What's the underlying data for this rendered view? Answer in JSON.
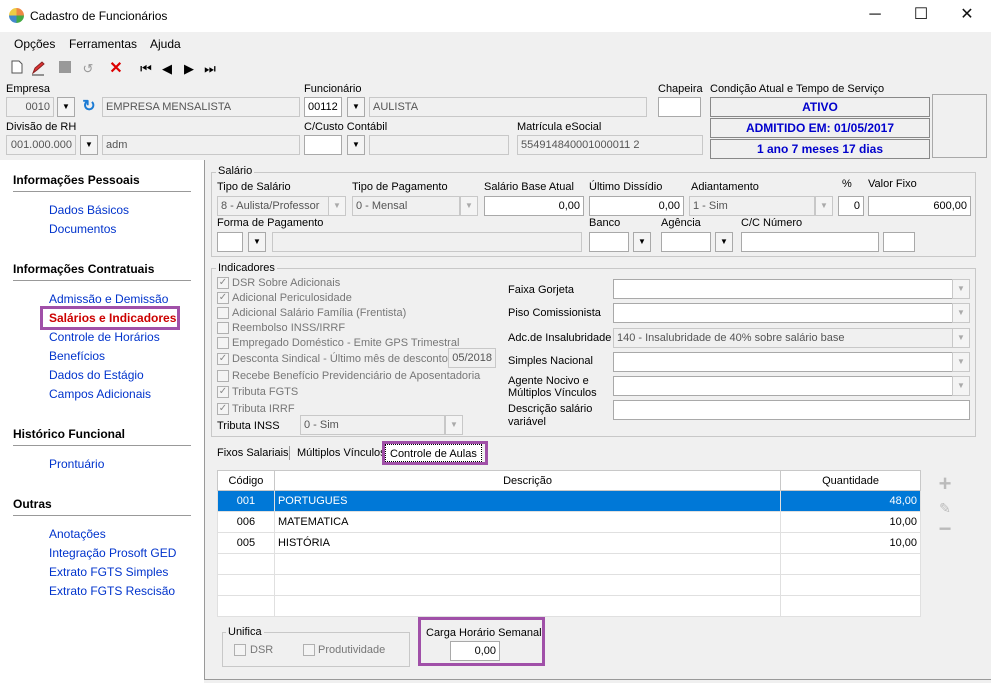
{
  "window": {
    "title": "Cadastro de Funcionários"
  },
  "menu": [
    "Opções",
    "Ferramentas",
    "Ajuda"
  ],
  "header": {
    "empresa_label": "Empresa",
    "empresa_code": "0010",
    "empresa_name": "EMPRESA MENSALISTA",
    "funcionario_label": "Funcionário",
    "funcionario_code": "00112",
    "funcionario_name": "AULISTA",
    "chapeira_label": "Chapeira",
    "chapeira_value": "",
    "condicao_label": "Condição Atual e Tempo de Serviço",
    "status": "ATIVO",
    "admitido": "ADMITIDO EM: 01/05/2017",
    "tempo": "1 ano 7 meses 17 dias",
    "divisao_label": "Divisão de RH",
    "divisao_code": "001.000.000",
    "divisao_name": "adm",
    "custo_label": "C/Custo Contábil",
    "matricula_label": "Matrícula eSocial",
    "matricula_value": "554914840001000011 2"
  },
  "sidebar": {
    "sections": [
      {
        "title": "Informações Pessoais",
        "items": [
          "Dados Básicos",
          "Documentos"
        ]
      },
      {
        "title": "Informações Contratuais",
        "items": [
          "Admissão e Demissão",
          "Salários e Indicadores",
          "Controle de Horários",
          "Benefícios",
          "Dados do Estágio",
          "Campos Adicionais"
        ]
      },
      {
        "title": "Histórico Funcional",
        "items": [
          "Prontuário"
        ]
      },
      {
        "title": "Outras",
        "items": [
          "Anotações",
          "Integração Prosoft GED",
          "Extrato FGTS Simples",
          "Extrato FGTS Rescisão"
        ]
      }
    ]
  },
  "salario": {
    "group_title": "Salário",
    "tipo_salario_label": "Tipo de Salário",
    "tipo_salario_value": "8 - Aulista/Professor",
    "tipo_pagamento_label": "Tipo de Pagamento",
    "tipo_pagamento_value": "0 - Mensal",
    "salario_base_label": "Salário Base Atual",
    "salario_base_value": "0,00",
    "ultimo_dissidio_label": "Último Dissídio",
    "ultimo_dissidio_value": "0,00",
    "adiantamento_label": "Adiantamento",
    "adiantamento_value": "1 - Sim",
    "percent_label": "%",
    "percent_value": "0",
    "valor_fixo_label": "Valor Fixo",
    "valor_fixo_value": "600,00",
    "forma_pagamento_label": "Forma de Pagamento",
    "banco_label": "Banco",
    "agencia_label": "Agência",
    "cc_label": "C/C Número"
  },
  "indicadores": {
    "group_title": "Indicadores",
    "checkboxes": [
      {
        "label": "DSR Sobre Adicionais",
        "checked": "✓"
      },
      {
        "label": "Adicional Periculosidade",
        "checked": "✓"
      },
      {
        "label": "Adicional Salário Família (Frentista)",
        "checked": ""
      },
      {
        "label": "Reembolso INSS/IRRF",
        "checked": ""
      },
      {
        "label": "Empregado Doméstico - Emite GPS Trimestral",
        "checked": ""
      },
      {
        "label": "Desconta Sindical - Último mês de desconto",
        "checked": "✓"
      },
      {
        "label": "Recebe Benefício Previdenciário de Aposentadoria",
        "checked": ""
      },
      {
        "label": "Tributa FGTS",
        "checked": "✓"
      },
      {
        "label": "Tributa IRRF",
        "checked": "✓"
      }
    ],
    "sindical_date": "05/2018",
    "tributa_inss_label": "Tributa INSS",
    "tributa_inss_value": "0 - Sim",
    "faixa_gorjeta_label": "Faixa Gorjeta",
    "piso_label": "Piso Comissionista",
    "insalubridade_label": "Adc.de Insalubridade",
    "insalubridade_value": "140 - Insalubridade de 40% sobre salário base",
    "simples_label": "Simples Nacional",
    "agente_label_1": "Agente Nocivo e",
    "agente_label_2": "Múltiplos Vínculos",
    "descricao_label_1": "Descrição salário",
    "descricao_label_2": "variável"
  },
  "tabs": [
    "Fixos Salariais",
    "Múltiplos Vínculos",
    "Controle de Aulas"
  ],
  "grid": {
    "headers": [
      "Código",
      "Descrição",
      "Quantidade"
    ],
    "rows": [
      {
        "codigo": "001",
        "descricao": "PORTUGUES",
        "quantidade": "48,00"
      },
      {
        "codigo": "006",
        "descricao": "MATEMATICA",
        "quantidade": "10,00"
      },
      {
        "codigo": "005",
        "descricao": "HISTÓRIA",
        "quantidade": "10,00"
      }
    ]
  },
  "unifica": {
    "title": "Unifica",
    "dsr": "DSR",
    "produtividade": "Produtividade"
  },
  "carga": {
    "title": "Carga Horário Semanal",
    "value": "0,00"
  },
  "colors": {
    "accent": "#0078d7",
    "highlight": "#a050a8",
    "status_text": "#0000cc",
    "link": "#0033cc",
    "active_link": "#cc0000"
  }
}
